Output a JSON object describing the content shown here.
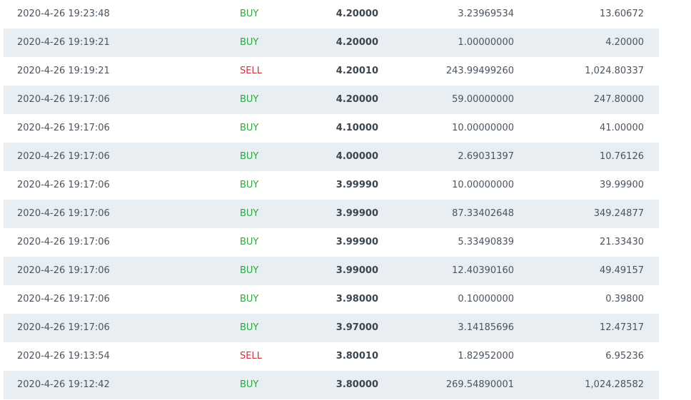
{
  "colors": {
    "buy": "#2ea640",
    "sell": "#d2323a",
    "row_alt": "#e9eef3"
  },
  "trades": [
    {
      "time": "2020-4-26 19:23:48",
      "side": "BUY",
      "price": "4.20000",
      "amount": "3.23969534",
      "total": "13.60672"
    },
    {
      "time": "2020-4-26 19:19:21",
      "side": "BUY",
      "price": "4.20000",
      "amount": "1.00000000",
      "total": "4.20000"
    },
    {
      "time": "2020-4-26 19:19:21",
      "side": "SELL",
      "price": "4.20010",
      "amount": "243.99499260",
      "total": "1,024.80337"
    },
    {
      "time": "2020-4-26 19:17:06",
      "side": "BUY",
      "price": "4.20000",
      "amount": "59.00000000",
      "total": "247.80000"
    },
    {
      "time": "2020-4-26 19:17:06",
      "side": "BUY",
      "price": "4.10000",
      "amount": "10.00000000",
      "total": "41.00000"
    },
    {
      "time": "2020-4-26 19:17:06",
      "side": "BUY",
      "price": "4.00000",
      "amount": "2.69031397",
      "total": "10.76126"
    },
    {
      "time": "2020-4-26 19:17:06",
      "side": "BUY",
      "price": "3.99990",
      "amount": "10.00000000",
      "total": "39.99900"
    },
    {
      "time": "2020-4-26 19:17:06",
      "side": "BUY",
      "price": "3.99900",
      "amount": "87.33402648",
      "total": "349.24877"
    },
    {
      "time": "2020-4-26 19:17:06",
      "side": "BUY",
      "price": "3.99900",
      "amount": "5.33490839",
      "total": "21.33430"
    },
    {
      "time": "2020-4-26 19:17:06",
      "side": "BUY",
      "price": "3.99000",
      "amount": "12.40390160",
      "total": "49.49157"
    },
    {
      "time": "2020-4-26 19:17:06",
      "side": "BUY",
      "price": "3.98000",
      "amount": "0.10000000",
      "total": "0.39800"
    },
    {
      "time": "2020-4-26 19:17:06",
      "side": "BUY",
      "price": "3.97000",
      "amount": "3.14185696",
      "total": "12.47317"
    },
    {
      "time": "2020-4-26 19:13:54",
      "side": "SELL",
      "price": "3.80010",
      "amount": "1.82952000",
      "total": "6.95236"
    },
    {
      "time": "2020-4-26 19:12:42",
      "side": "BUY",
      "price": "3.80000",
      "amount": "269.54890001",
      "total": "1,024.28582"
    }
  ]
}
